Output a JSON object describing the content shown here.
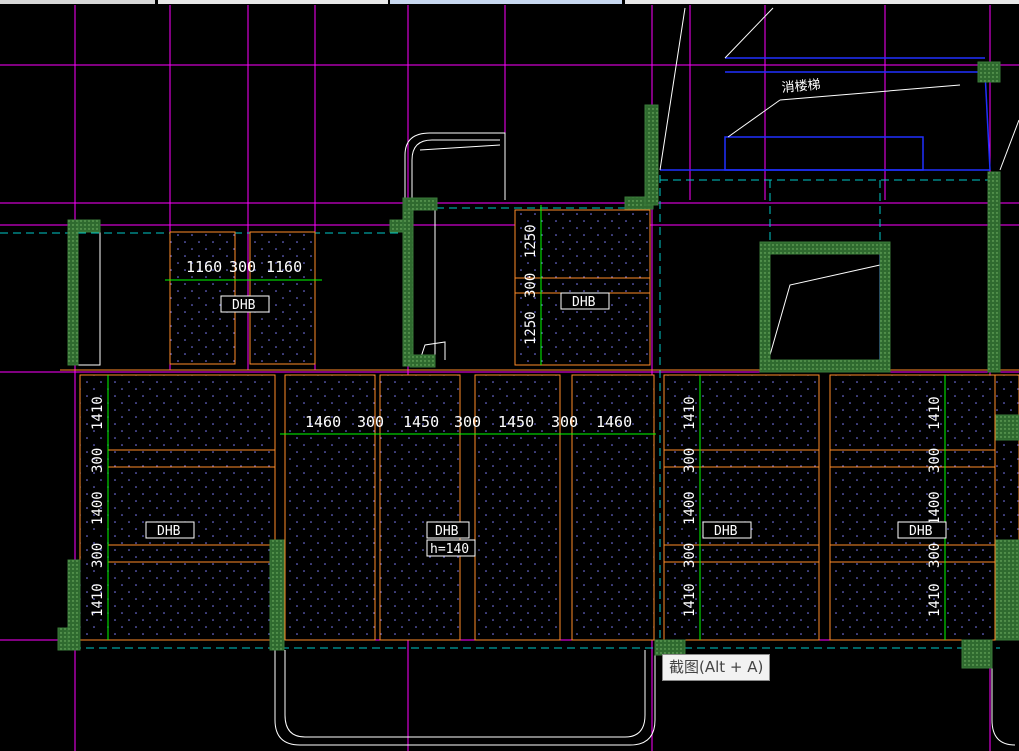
{
  "colors": {
    "background": "#000000",
    "axis": "#ff00ff",
    "grid_cyan": "#00c8c8",
    "beam_orange": "#ff8c28",
    "dimension": "#00ff00",
    "text": "#ffffff",
    "column": "#3a7a3a",
    "stair_blue": "#2030ff",
    "hatch": "#8080ff"
  },
  "top_strip_segments": [
    {
      "label": ""
    },
    {
      "label": ""
    },
    {
      "label": ""
    },
    {
      "label": ""
    }
  ],
  "stair_label": "消楼梯",
  "slab_tag": "DHB",
  "slab_tag_thickness": "h=140",
  "dimensions": {
    "upper_left": [
      "1160",
      "300",
      "1160"
    ],
    "upper_mid_vertical": [
      "1250",
      "300",
      "1250"
    ],
    "middle_horizontal": [
      "1460",
      "300",
      "1450",
      "300",
      "1450",
      "300",
      "1460"
    ],
    "left_vertical": [
      "1410",
      "300",
      "1400",
      "300",
      "1410"
    ],
    "right_vertical_a": [
      "1410",
      "300",
      "1400",
      "300",
      "1410"
    ],
    "right_vertical_b": [
      "1410",
      "300",
      "1400",
      "300",
      "1410"
    ]
  },
  "tooltip": {
    "text": "截图(Alt + A)"
  }
}
